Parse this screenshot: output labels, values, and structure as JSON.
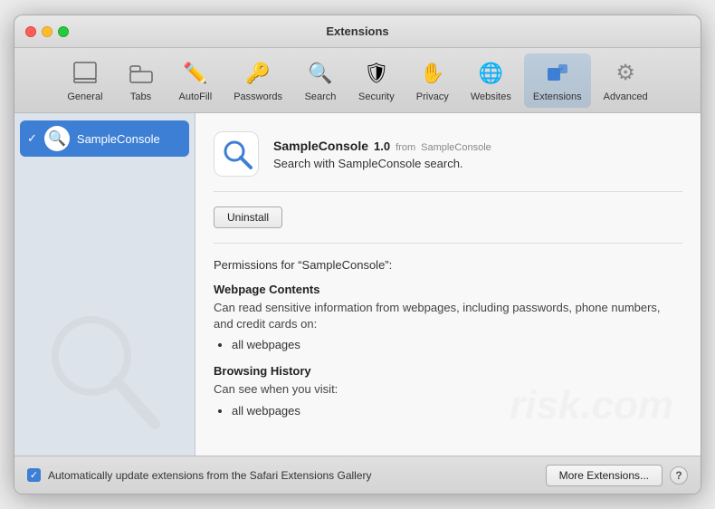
{
  "window": {
    "title": "Extensions"
  },
  "toolbar": {
    "items": [
      {
        "id": "general",
        "label": "General",
        "icon": "general-icon"
      },
      {
        "id": "tabs",
        "label": "Tabs",
        "icon": "tabs-icon"
      },
      {
        "id": "autofill",
        "label": "AutoFill",
        "icon": "autofill-icon"
      },
      {
        "id": "passwords",
        "label": "Passwords",
        "icon": "passwords-icon"
      },
      {
        "id": "search",
        "label": "Search",
        "icon": "search-icon"
      },
      {
        "id": "security",
        "label": "Security",
        "icon": "security-icon"
      },
      {
        "id": "privacy",
        "label": "Privacy",
        "icon": "privacy-icon"
      },
      {
        "id": "websites",
        "label": "Websites",
        "icon": "websites-icon"
      },
      {
        "id": "extensions",
        "label": "Extensions",
        "icon": "extensions-icon",
        "active": true
      },
      {
        "id": "advanced",
        "label": "Advanced",
        "icon": "advanced-icon"
      }
    ]
  },
  "sidebar": {
    "items": [
      {
        "name": "SampleConsole",
        "checked": true
      }
    ]
  },
  "extension": {
    "name": "SampleConsole",
    "version": "1.0",
    "from_label": "from",
    "from_source": "SampleConsole",
    "description": "Search with SampleConsole search.",
    "uninstall_label": "Uninstall",
    "permissions_heading": "Permissions for “SampleConsole”:",
    "permissions": [
      {
        "title": "Webpage Contents",
        "description": "Can read sensitive information from webpages, including passwords, phone numbers, and credit cards on:",
        "items": [
          "all webpages"
        ]
      },
      {
        "title": "Browsing History",
        "description": "Can see when you visit:",
        "items": [
          "all webpages"
        ]
      }
    ]
  },
  "bottom": {
    "auto_update_label": "Automatically update extensions from the Safari Extensions Gallery",
    "more_extensions_label": "More Extensions...",
    "help_label": "?"
  }
}
